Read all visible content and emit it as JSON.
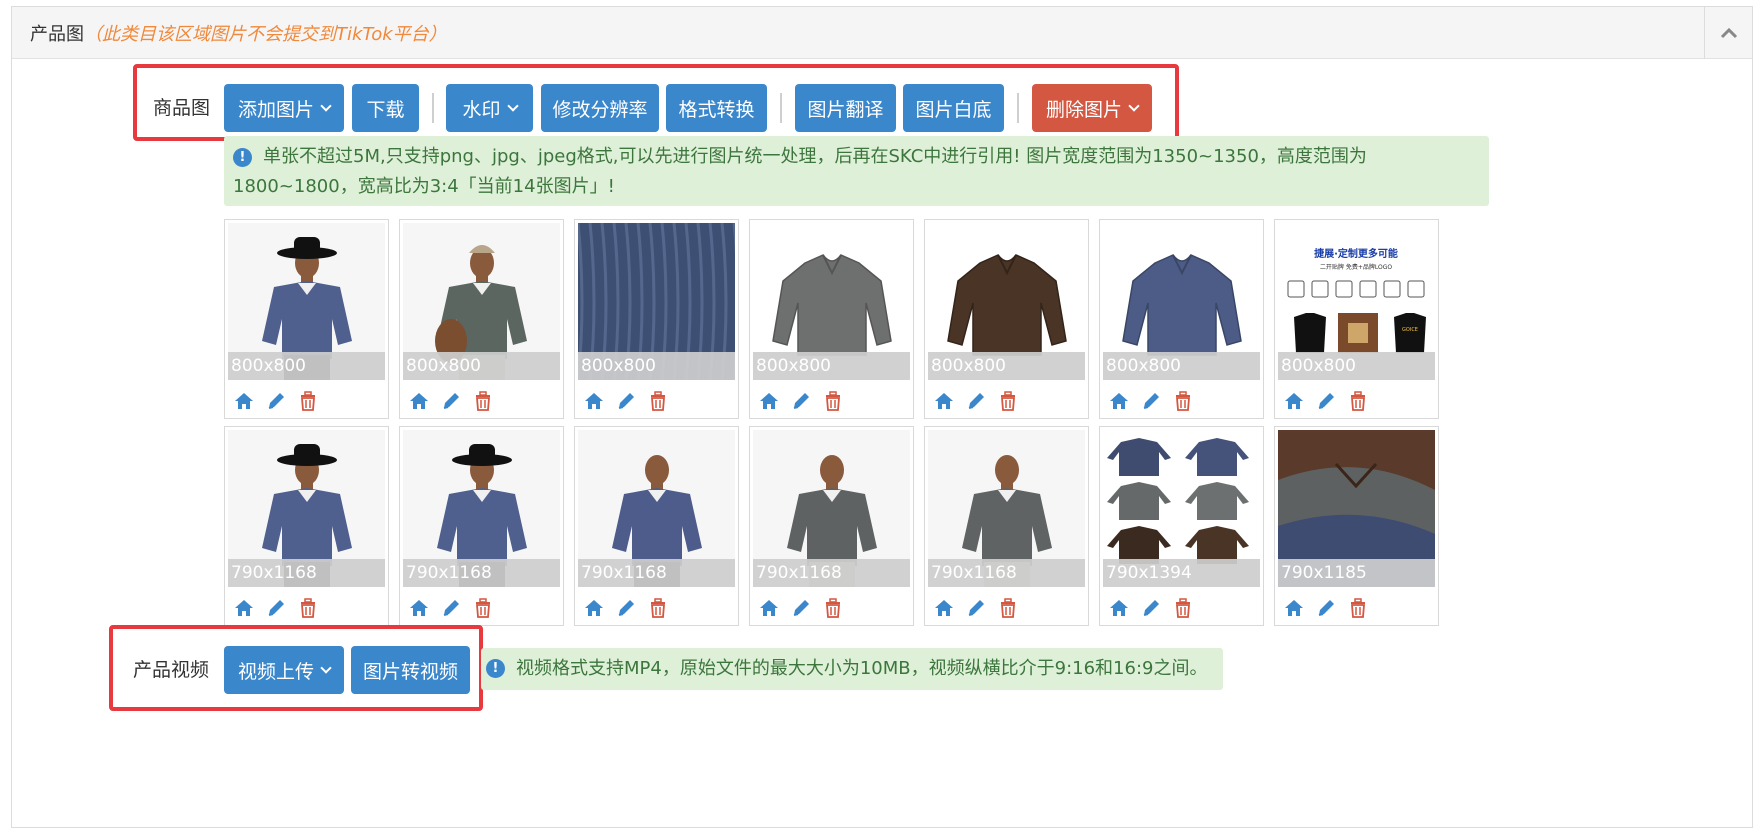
{
  "panel": {
    "title": "产品图",
    "note": "（此类目该区域图片不会提交到TikTok平台）"
  },
  "product_images": {
    "label": "商品图",
    "toolbar": {
      "add": "添加图片",
      "download": "下载",
      "watermark": "水印",
      "resolution": "修改分辨率",
      "format": "格式转换",
      "translate": "图片翻译",
      "white_bg": "图片白底",
      "delete": "删除图片"
    },
    "notice": "单张不超过5M,只支持png、jpg、jpeg格式,可以先进行图片统一处理，后再在SKC中进行引用! 图片宽度范围为1350~1350，高度范围为1800~1800，宽高比为3:4「当前14张图片」!",
    "thumbnails": [
      {
        "size": "800x800",
        "subject": "model-hat-blue-sweater"
      },
      {
        "size": "800x800",
        "subject": "model-cap-bag-gray-sweater"
      },
      {
        "size": "800x800",
        "subject": "knit-fabric-closeup"
      },
      {
        "size": "800x800",
        "subject": "gray-sweater-flat"
      },
      {
        "size": "800x800",
        "subject": "brown-sweater-flat"
      },
      {
        "size": "800x800",
        "subject": "blue-sweater-flat"
      },
      {
        "size": "800x800",
        "subject": "customization-infographic"
      },
      {
        "size": "790x1168",
        "subject": "model-hat-blue-sweater"
      },
      {
        "size": "790x1168",
        "subject": "model-hat-blue-sweater-front"
      },
      {
        "size": "790x1168",
        "subject": "model-blue-sweater"
      },
      {
        "size": "790x1168",
        "subject": "model-gray-sweater"
      },
      {
        "size": "790x1168",
        "subject": "model-gray-sweater-back"
      },
      {
        "size": "790x1394",
        "subject": "sweater-color-grid"
      },
      {
        "size": "790x1185",
        "subject": "stacked-sweaters"
      }
    ],
    "infographic_text": {
      "headline": "捷展·定制更多可能",
      "subline": "二开贴牌 免费+品牌LOGO",
      "patch": "GOICE"
    }
  },
  "video": {
    "label": "产品视频",
    "upload": "视频上传",
    "to_video": "图片转视频",
    "notice": "视频格式支持MP4，原始文件的最大大小为10MB，视频纵横比介于9:16和16:9之间。"
  },
  "colors": {
    "primary": "#3b87cc",
    "danger": "#d45741",
    "highlight": "#e8393e",
    "alert_bg": "#dff0d8",
    "alert_text": "#3c763d",
    "note": "#f0893c",
    "icon_blue": "#3b87cc",
    "icon_red": "#d45741"
  }
}
